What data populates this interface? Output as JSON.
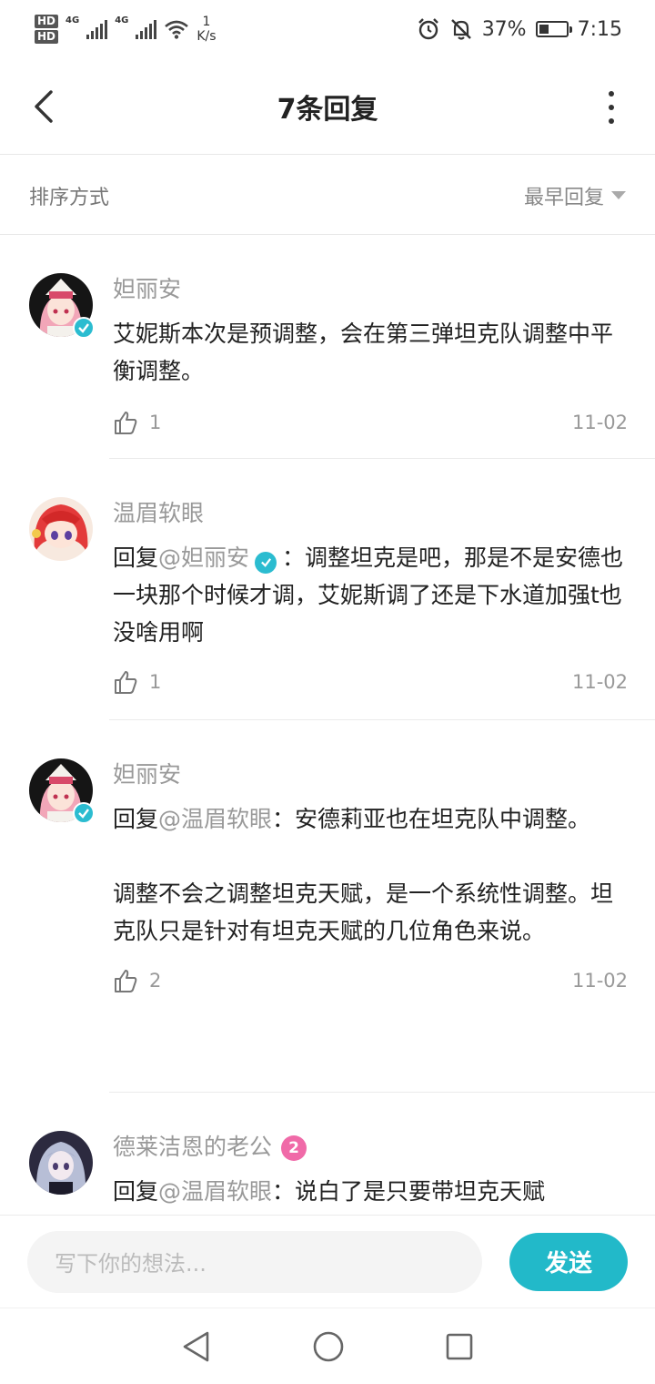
{
  "status_bar": {
    "hd1": "HD",
    "hd2": "HD",
    "net1": "4G",
    "net2": "4G",
    "speed_value": "1",
    "speed_unit": "K/s",
    "battery_percent": "37%",
    "battery_level": 0.37,
    "time": "7:15"
  },
  "header": {
    "title": "7条回复"
  },
  "sort": {
    "label": "排序方式",
    "selected": "最早回复"
  },
  "comments": [
    {
      "author": "妲丽安",
      "verified": true,
      "text": "艾妮斯本次是预调整，会在第三弹坦克队调整中平衡调整。",
      "likes": "1",
      "date": "11-02"
    },
    {
      "author": "温眉软眼",
      "reply_prefix": "回复",
      "reply_to": "@妲丽安",
      "text": "：调整坦克是吧，那是不是安德也一块那个时候才调，艾妮斯调了还是下水道加强t也没啥用啊",
      "likes": "1",
      "date": "11-02"
    },
    {
      "author": "妲丽安",
      "verified": true,
      "reply_prefix": "回复",
      "reply_to": "@温眉软眼",
      "text": "：安德莉亚也在坦克队中调整。",
      "text2": "调整不会之调整坦克天赋，是一个系统性调整。坦克队只是针对有坦克天赋的几位角色来说。",
      "likes": "2",
      "date": "11-02"
    },
    {
      "author": "德莱洁恩的老公",
      "level": "2",
      "reply_prefix": "回复",
      "reply_to": "@温眉软眼",
      "text": "：说白了是只要带坦克天赋"
    }
  ],
  "input": {
    "placeholder": "写下你的想法...",
    "send_label": "发送"
  },
  "colors": {
    "accent": "#22b9c9",
    "verified": "#2bbcd0",
    "level_badge": "#f06aa8"
  },
  "icons": [
    "back-arrow-icon",
    "more-vertical-icon",
    "sort-dropdown-icon",
    "thumbs-up-icon",
    "verified-icon",
    "nav-back-icon",
    "nav-home-icon",
    "nav-recent-icon"
  ]
}
